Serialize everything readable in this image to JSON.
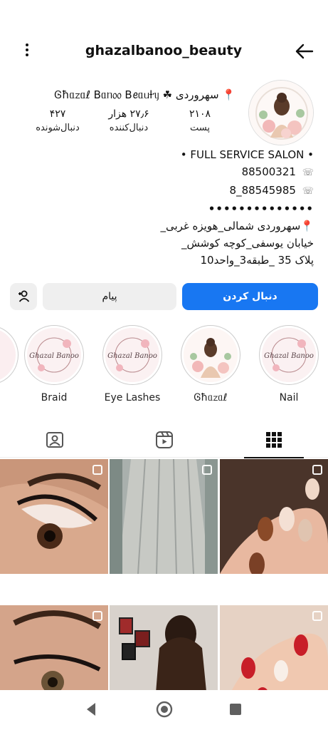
{
  "header": {
    "username": "ghazalbanoo_beauty"
  },
  "profile": {
    "display_name": "📍 سهروردی ☘ Ꮆħᥲᤁᥲℓ Bᥲᥒ᥆᥆ Bꫀᥲᥙƚᥡ",
    "stats": [
      {
        "value": "۲۱۰۸",
        "label": "پست"
      },
      {
        "value": "۲۷٫۶ هزار",
        "label": "دنبال‌کننده"
      },
      {
        "value": "۴۲۷",
        "label": "دنبال‌شونده"
      }
    ]
  },
  "bio": {
    "line1": "• FULL SERVICE SALON •",
    "phone1": "88500321",
    "phone2": "8_88545985",
    "dots": "••••••••••••••",
    "address1": "📍سهروردی شمالی_هویزه غربی_",
    "address2": "خیابان یوسفی_کوچه کوشش_",
    "address3": "پلاک 35 _طبقه3_واحد10"
  },
  "actions": {
    "follow_label": "دنبال کردن",
    "message_label": "پیام"
  },
  "highlights": [
    {
      "label": "Nail"
    },
    {
      "label": "Ꮆħᥲᤁᥲℓ"
    },
    {
      "label": "Eye Lashes"
    },
    {
      "label": "Braid"
    }
  ],
  "logo_text": "Ghazal Banoo",
  "icons": {
    "menu": "more-vertical-icon",
    "back": "arrow-left-icon",
    "add_user": "person-add-icon",
    "tab_tagged": "tagged-icon",
    "tab_reels": "reels-icon",
    "tab_grid": "grid-icon",
    "phone": "phone-icon"
  },
  "colors": {
    "follow": "#1877f2",
    "secondary_button": "#efefef"
  }
}
